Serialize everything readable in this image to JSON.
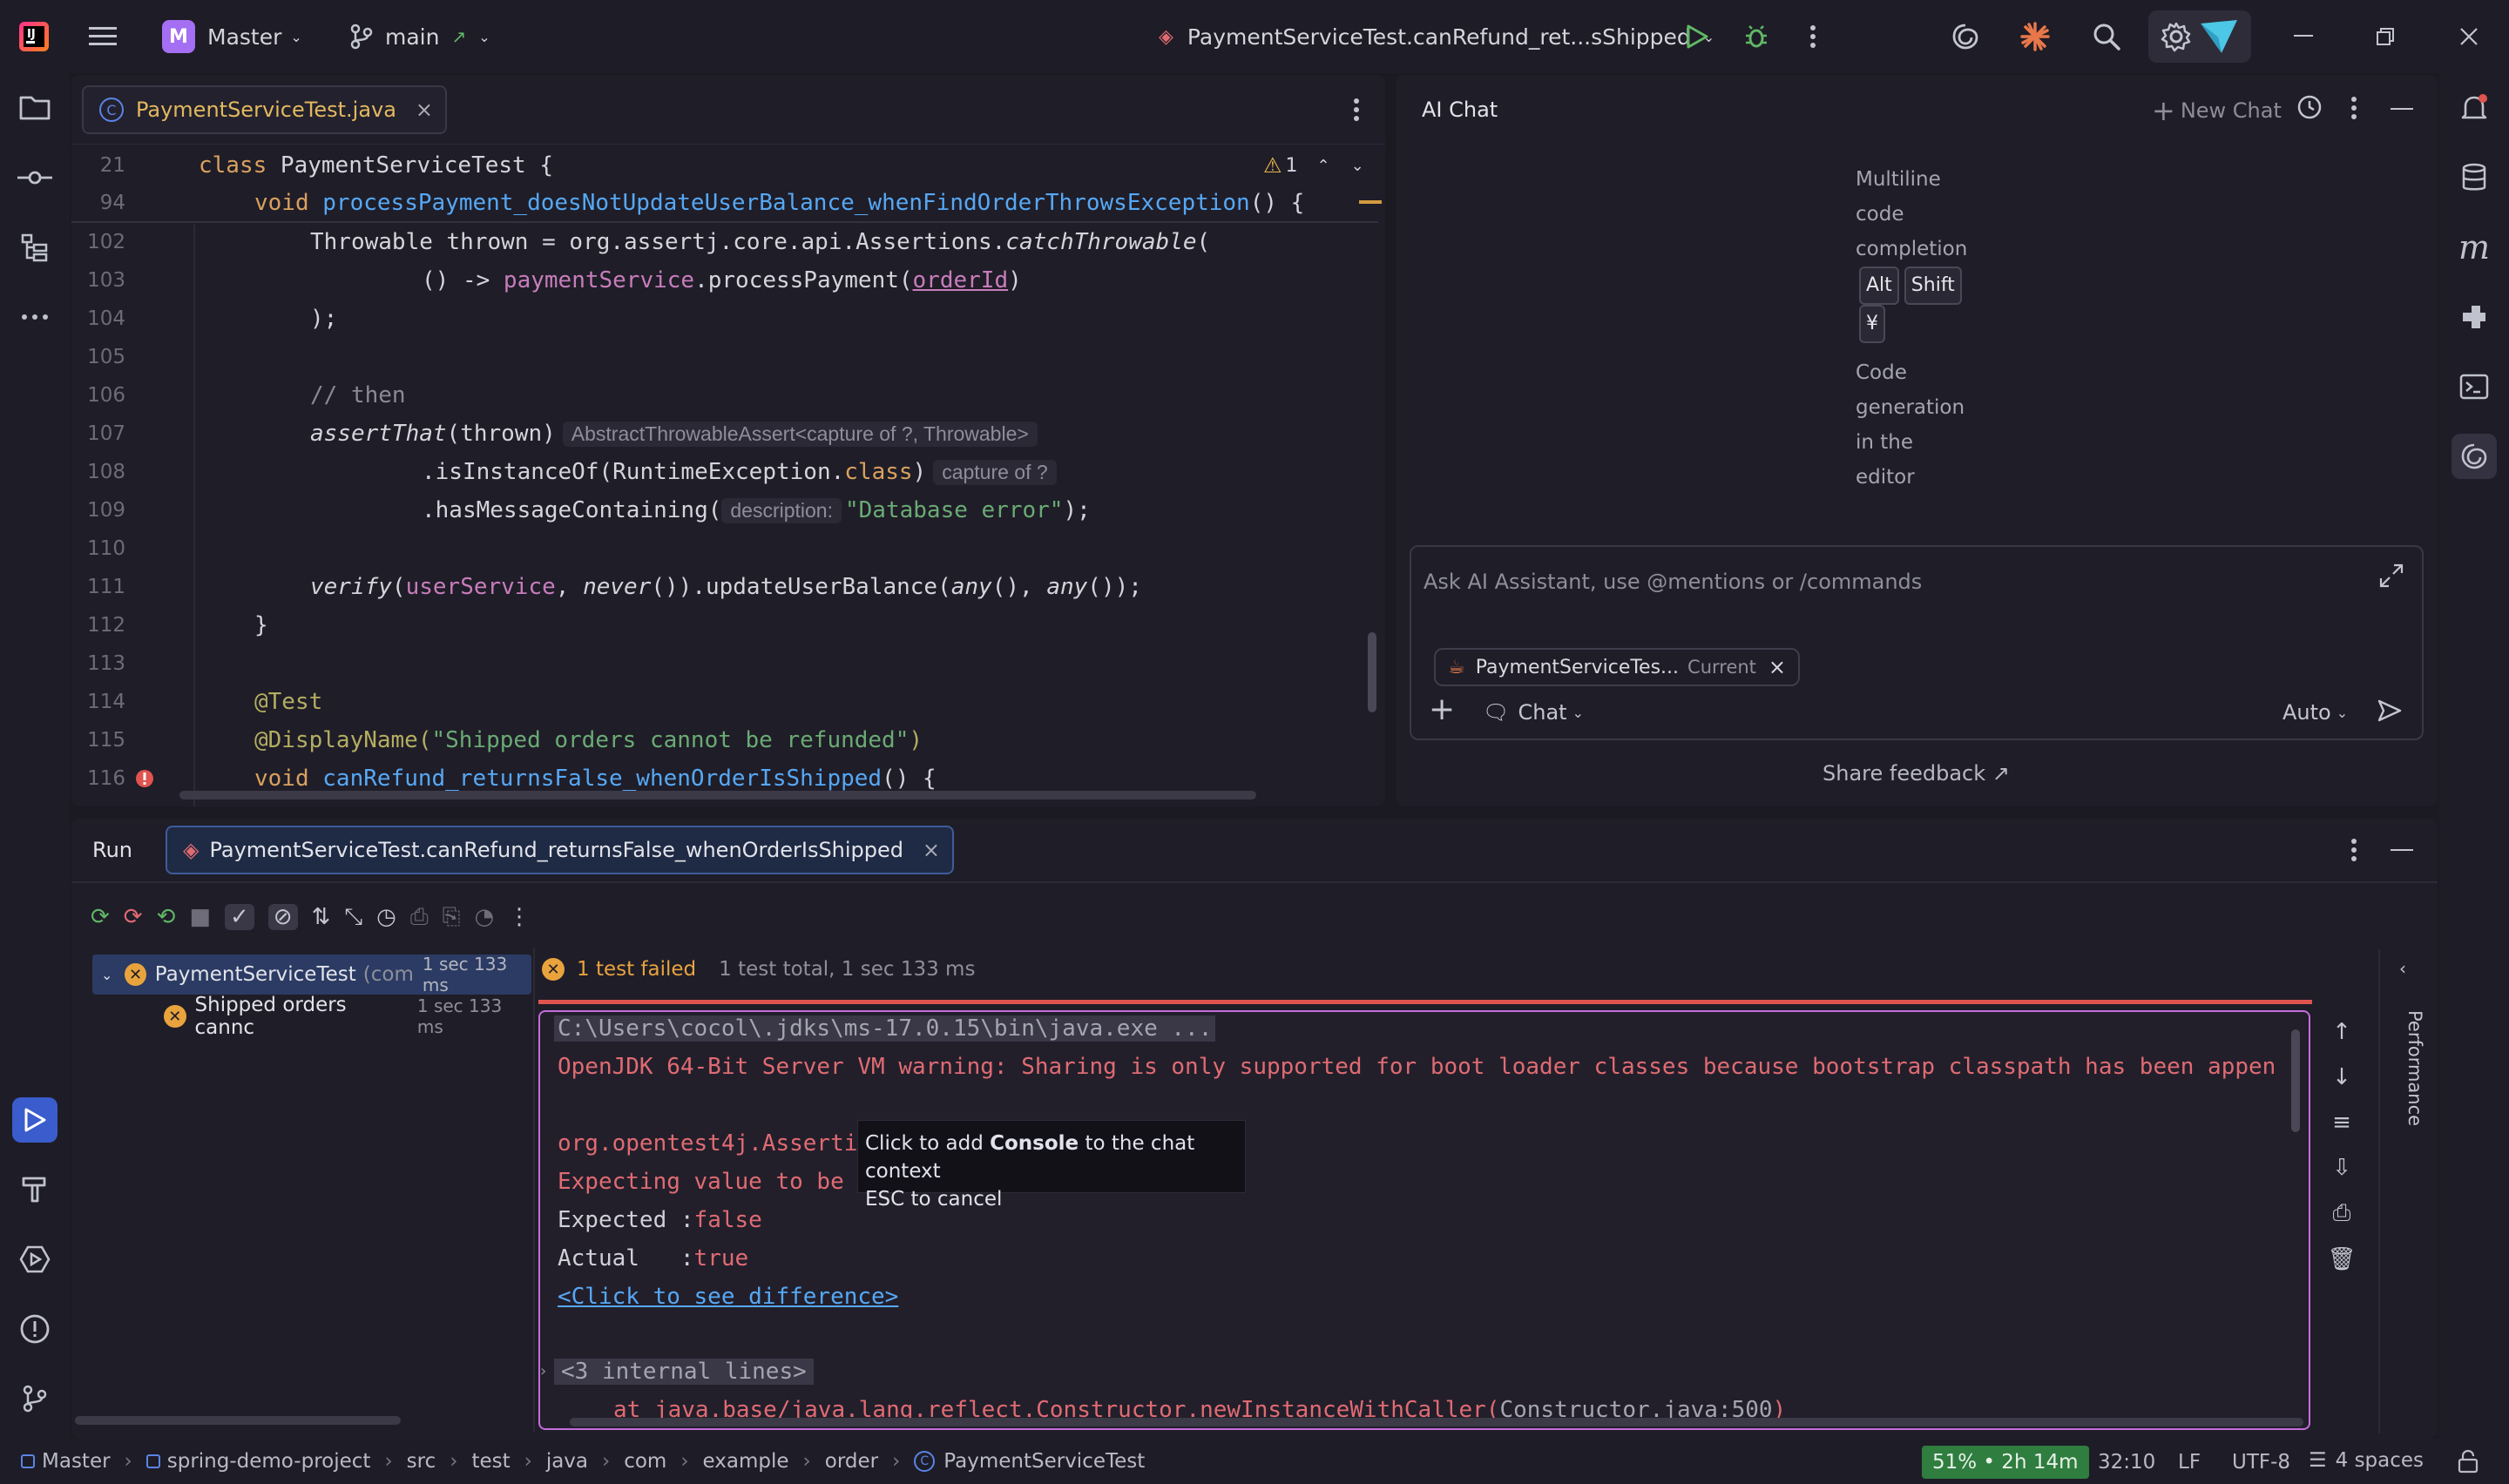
{
  "titlebar": {
    "project_initial": "M",
    "project_name": "Master",
    "branch": "main",
    "run_config": "PaymentServiceTest.canRefund_ret...sShipped"
  },
  "editor": {
    "tab_label": "PaymentServiceTest.java",
    "warning_count": "1",
    "lines": [
      {
        "n": "21"
      },
      {
        "n": "94"
      },
      {
        "n": "102"
      },
      {
        "n": "103"
      },
      {
        "n": "104"
      },
      {
        "n": "105"
      },
      {
        "n": "106"
      },
      {
        "n": "107"
      },
      {
        "n": "108"
      },
      {
        "n": "109"
      },
      {
        "n": "110"
      },
      {
        "n": "111"
      },
      {
        "n": "112"
      },
      {
        "n": "113"
      },
      {
        "n": "114"
      },
      {
        "n": "115"
      },
      {
        "n": "116"
      }
    ],
    "code": {
      "l21_kw": "class ",
      "l21_rest": "PaymentServiceTest {",
      "l94_kw": "void ",
      "l94_fn": "processPayment_doesNotUpdateUserBalance_whenFindOrderThrowsException",
      "l94_rest": "() {",
      "l102_a": "Throwable thrown = org.assertj.core.api.Assertions.",
      "l102_b": "catchThrowable",
      "l102_c": "(",
      "l103_a": "() -> ",
      "l103_b": "paymentService",
      "l103_c": ".processPayment(",
      "l103_d": "orderId",
      "l103_e": ")",
      "l104": ");",
      "l106": "// then",
      "l107_a": "assertThat",
      "l107_b": "(thrown)",
      "l107_hint": "AbstractThrowableAssert<capture of ?, Throwable>",
      "l108_a": ".isInstanceOf(RuntimeException.",
      "l108_b": "class",
      "l108_c": ")",
      "l108_hint": "capture of ?",
      "l109_a": ".hasMessageContaining(",
      "l109_hint": "description:",
      "l109_str": "\"Database error\"",
      "l109_c": ");",
      "l111_a": "verify",
      "l111_b": "(",
      "l111_c": "userService",
      "l111_d": ", ",
      "l111_e": "never",
      "l111_f": "()).updateUserBalance(",
      "l111_g": "any",
      "l111_h": "(), ",
      "l111_i": "any",
      "l111_j": "());",
      "l112": "}",
      "l114": "@Test",
      "l115_a": "@DisplayName(",
      "l115_b": "\"Shipped orders cannot be refunded\"",
      "l115_c": ")",
      "l116_kw": "void ",
      "l116_fn": "canRefund_returnsFalse_whenOrderIsShipped",
      "l116_rest": "() {"
    }
  },
  "aichat": {
    "title": "AI Chat",
    "new_chat": "New Chat",
    "tip1_line1": "Multiline",
    "tip1_line2": "code",
    "tip1_line3": "completion",
    "key_alt": "Alt",
    "key_shift": "Shift",
    "key_yen": "¥",
    "tip2_line1": "Code",
    "tip2_line2": "generation",
    "tip2_line3": "in the",
    "tip2_line4": "editor",
    "input_placeholder": "Ask AI Assistant, use @mentions or /commands",
    "context_chip": "PaymentServiceTes...",
    "context_current": "Current",
    "mode": "Chat",
    "model": "Auto",
    "share_feedback": "Share feedback ↗"
  },
  "run": {
    "title": "Run",
    "tab_label": "PaymentServiceTest.canRefund_returnsFalse_whenOrderIsShipped",
    "tree_root": "PaymentServiceTest",
    "tree_root_suffix": "(com",
    "tree_root_time": "1 sec 133 ms",
    "tree_child": "Shipped orders cannc",
    "tree_child_time": "1 sec 133 ms",
    "status_failed": "1 test failed",
    "status_summary": "1 test total, 1 sec 133 ms",
    "console": {
      "l1": "C:\\Users\\cocol\\.jdks\\ms-17.0.15\\bin\\java.exe ...",
      "l2": "OpenJDK 64-Bit Server VM warning: Sharing is only supported for boot loader classes because bootstrap classpath has been appen",
      "l3": "org.opentest4j.Asserti",
      "l4": "Expecting value to be ",
      "l5_label": "Expected :",
      "l5_val": "false",
      "l6_label": "Actual   :",
      "l6_val": "true",
      "l7": "<Click to see difference>",
      "l8": "<3 internal lines>",
      "l9_a": "at java.base/java.lang.reflect.Constructor.newInstanceWithCaller(",
      "l9_b": "Constructor.java:500",
      "l9_c": ")"
    },
    "tooltip_line1_a": "Click to add ",
    "tooltip_line1_b": "Console",
    "tooltip_line1_c": " to the chat context",
    "tooltip_line2": "ESC to cancel",
    "side_label": "Performance"
  },
  "statusbar": {
    "crumbs": [
      "Master",
      "spring-demo-project",
      "src",
      "test",
      "java",
      "com",
      "example",
      "order",
      "PaymentServiceTest"
    ],
    "memory": "51% • 2h 14m",
    "position": "32:10",
    "line_sep": "LF",
    "encoding": "UTF-8",
    "indent": "4 spaces"
  },
  "colors": {
    "accent_purple": "#a46ff2",
    "error_red": "#e06b72",
    "console_border": "#c56ddb",
    "memory_green": "#2f7d3f"
  }
}
